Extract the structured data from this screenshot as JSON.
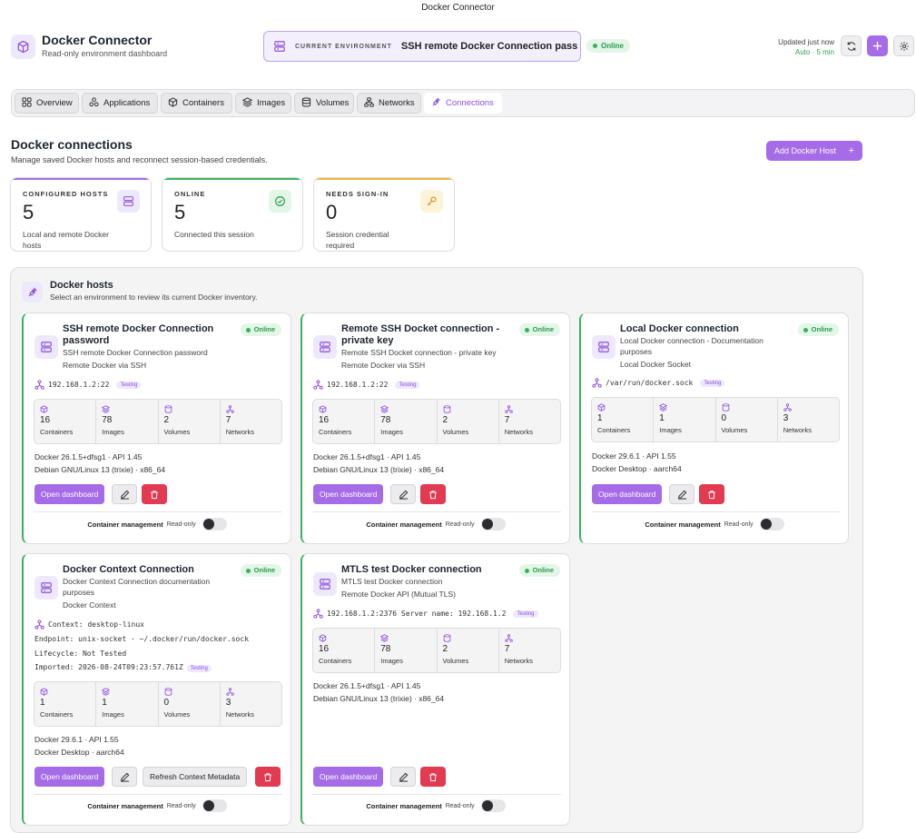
{
  "window": {
    "title": "Docker Connector"
  },
  "header": {
    "title": "Docker Connector",
    "subtitle": "Read-only environment dashboard",
    "env_label": "CURRENT ENVIRONMENT",
    "env_value": "SSH remote Docker Connection pass",
    "status": "Online",
    "updated": "Updated just now",
    "auto": "Auto · 5 min"
  },
  "tabs": [
    {
      "label": "Overview",
      "icon": "grid-icon"
    },
    {
      "label": "Applications",
      "icon": "apps-icon"
    },
    {
      "label": "Containers",
      "icon": "box-icon"
    },
    {
      "label": "Images",
      "icon": "layers-icon"
    },
    {
      "label": "Volumes",
      "icon": "database-icon"
    },
    {
      "label": "Networks",
      "icon": "network-icon"
    },
    {
      "label": "Connections",
      "icon": "plug-icon",
      "active": true
    }
  ],
  "section": {
    "title": "Docker connections",
    "subtitle": "Manage saved Docker hosts and reconnect session-based credentials.",
    "add_button": "Add Docker Host"
  },
  "stats": [
    {
      "label": "CONFIGURED HOSTS",
      "value": "5",
      "desc": "Local and remote Docker hosts"
    },
    {
      "label": "ONLINE",
      "value": "5",
      "desc": "Connected this session"
    },
    {
      "label": "NEEDS SIGN-IN",
      "value": "0",
      "desc": "Session credential required"
    }
  ],
  "hosts": {
    "title": "Docker hosts",
    "subtitle": "Select an environment to review its current Docker inventory."
  },
  "labels": {
    "online": "Online",
    "testing": "Testing",
    "containers": "Containers",
    "images": "Images",
    "volumes": "Volumes",
    "networks": "Networks",
    "open_dashboard": "Open dashboard",
    "refresh_meta": "Refresh Context Metadata",
    "container_mgmt": "Container management",
    "read_only": "Read-only"
  },
  "cards": [
    {
      "title": "SSH remote Docker Connection password",
      "desc": "SSH remote Docker Connection password",
      "type": "Remote Docker via SSH",
      "address": "192.168.1.2:22",
      "stats": [
        "16",
        "78",
        "2",
        "7"
      ],
      "meta1": "Docker 26.1.5+dfsg1 · API 1.45",
      "meta2": "Debian GNU/Linux 13 (trixie) · x86_64"
    },
    {
      "title": "Remote SSH Docket connection - private key",
      "desc": "Remote SSH Docket connection - private key",
      "type": "Remote Docker via SSH",
      "address": "192.168.1.2:22",
      "stats": [
        "16",
        "78",
        "2",
        "7"
      ],
      "meta1": "Docker 26.1.5+dfsg1 · API 1.45",
      "meta2": "Debian GNU/Linux 13 (trixie) · x86_64"
    },
    {
      "title": "Local Docker connection",
      "desc": "Local Docker connection - Documentation purposes",
      "type": "Local Docker Socket",
      "address": "/var/run/docker.sock",
      "stats": [
        "1",
        "1",
        "0",
        "3"
      ],
      "meta1": "Docker 29.6.1 · API 1.55",
      "meta2": "Docker Desktop · aarch64"
    },
    {
      "title": "Docker Context Connection",
      "desc": "Docker Context Connection documentation purposes",
      "type": "Docker Context",
      "context": "Context: desktop-linux",
      "endpoint": "Endpoint: unix-socket · ~/.docker/run/docker.sock",
      "lifecycle": "Lifecycle: Not Tested",
      "imported": "Imported: 2026-08-24T09:23:57.761Z",
      "stats": [
        "1",
        "1",
        "0",
        "3"
      ],
      "meta1": "Docker 29.6.1 · API 1.55",
      "meta2": "Docker Desktop · aarch64"
    },
    {
      "title": "MTLS test Docker connection",
      "desc": "MTLS test Docker connection",
      "type": "Remote Docker API (Mutual TLS)",
      "address": "192.168.1.2:2376 Server name: 192.168.1.2",
      "stats": [
        "16",
        "78",
        "2",
        "7"
      ],
      "meta1": "Docker 26.1.5+dfsg1 · API 1.45",
      "meta2": "Debian GNU/Linux 13 (trixie) · x86_64"
    }
  ]
}
